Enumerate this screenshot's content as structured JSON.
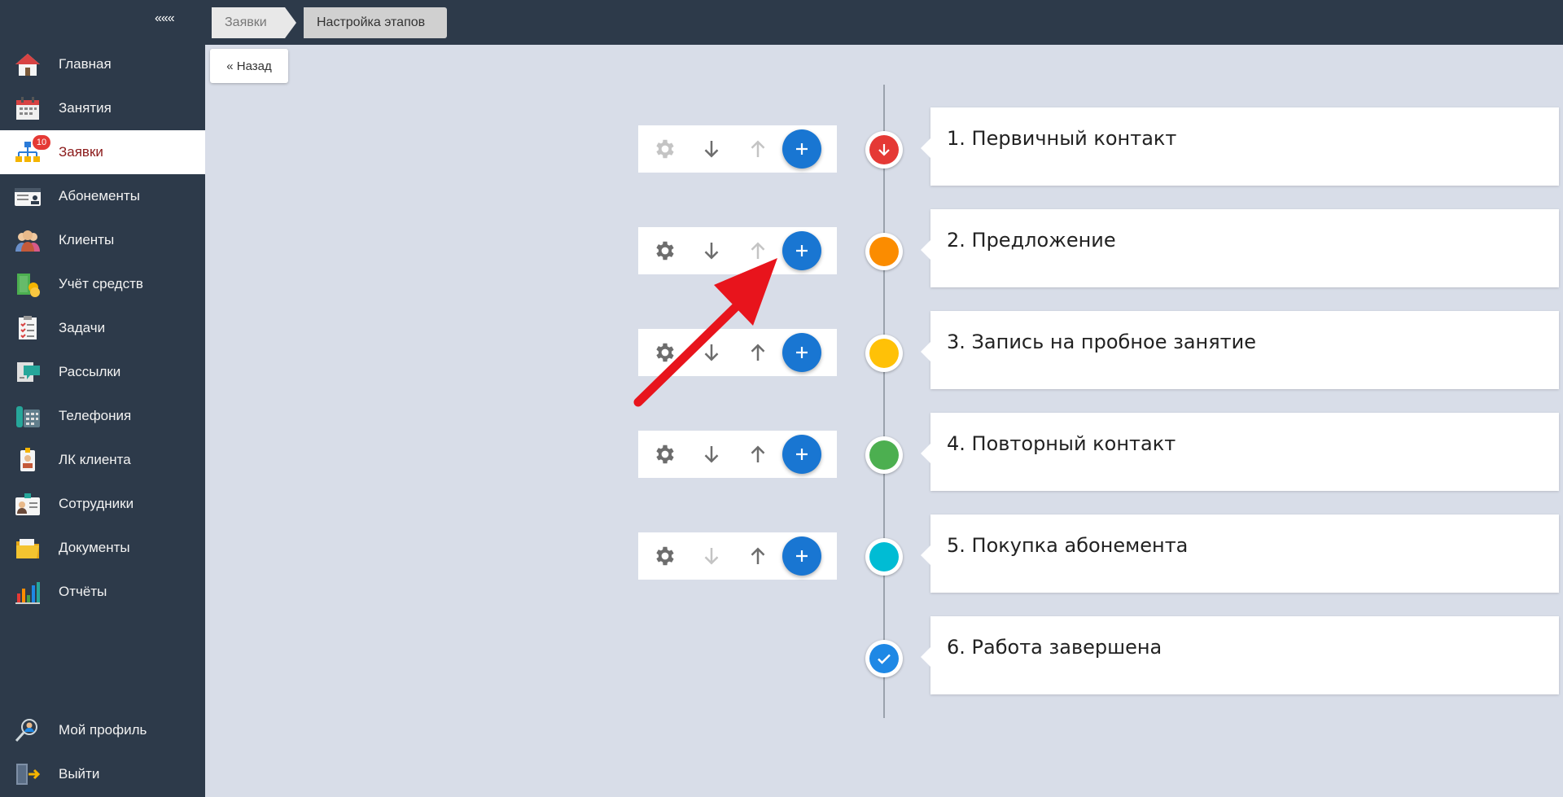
{
  "sidebar": {
    "collapse_label": "«««",
    "items": [
      {
        "label": "Главная",
        "icon": "home-icon"
      },
      {
        "label": "Занятия",
        "icon": "calendar-icon"
      },
      {
        "label": "Заявки",
        "icon": "org-chart-icon",
        "badge": "10",
        "active": true
      },
      {
        "label": "Абонементы",
        "icon": "membership-card-icon"
      },
      {
        "label": "Клиенты",
        "icon": "clients-icon"
      },
      {
        "label": "Учёт средств",
        "icon": "money-icon"
      },
      {
        "label": "Задачи",
        "icon": "tasks-icon"
      },
      {
        "label": "Рассылки",
        "icon": "mailing-icon"
      },
      {
        "label": "Телефония",
        "icon": "phone-icon"
      },
      {
        "label": "ЛК клиента",
        "icon": "client-badge-icon"
      },
      {
        "label": "Сотрудники",
        "icon": "staff-icon"
      },
      {
        "label": "Документы",
        "icon": "documents-icon"
      },
      {
        "label": "Отчёты",
        "icon": "reports-icon"
      }
    ],
    "bottom_items": [
      {
        "label": "Мой профиль",
        "icon": "profile-icon"
      },
      {
        "label": "Выйти",
        "icon": "logout-icon"
      }
    ]
  },
  "breadcrumbs": [
    {
      "label": "Заявки"
    },
    {
      "label": "Настройка этапов"
    }
  ],
  "back_button": {
    "label": "« Назад"
  },
  "colors": {
    "sidebar_bg": "#2d3a4a",
    "content_bg": "#d8dde8",
    "accent_blue": "#1976d2",
    "annotation_arrow": "#e8141c"
  },
  "stages": [
    {
      "title": "1. Первичный контакт",
      "color": "#e53935",
      "marker_icon": "arrow-down-icon",
      "has_toolbar": true,
      "gear_enabled": false,
      "down_enabled": true,
      "up_enabled": false
    },
    {
      "title": "2. Предложение",
      "color": "#fb8c00",
      "marker_icon": "",
      "has_toolbar": true,
      "gear_enabled": true,
      "down_enabled": true,
      "up_enabled": false
    },
    {
      "title": "3. Запись на пробное занятие",
      "color": "#ffc107",
      "marker_icon": "",
      "has_toolbar": true,
      "gear_enabled": true,
      "down_enabled": true,
      "up_enabled": true
    },
    {
      "title": "4. Повторный контакт",
      "color": "#4caf50",
      "marker_icon": "",
      "has_toolbar": true,
      "gear_enabled": true,
      "down_enabled": true,
      "up_enabled": true
    },
    {
      "title": "5. Покупка абонемента",
      "color": "#00bcd4",
      "marker_icon": "",
      "has_toolbar": true,
      "gear_enabled": true,
      "down_enabled": false,
      "up_enabled": true
    },
    {
      "title": "6. Работа завершена",
      "color": "#1e88e5",
      "marker_icon": "check-icon",
      "has_toolbar": false
    }
  ]
}
